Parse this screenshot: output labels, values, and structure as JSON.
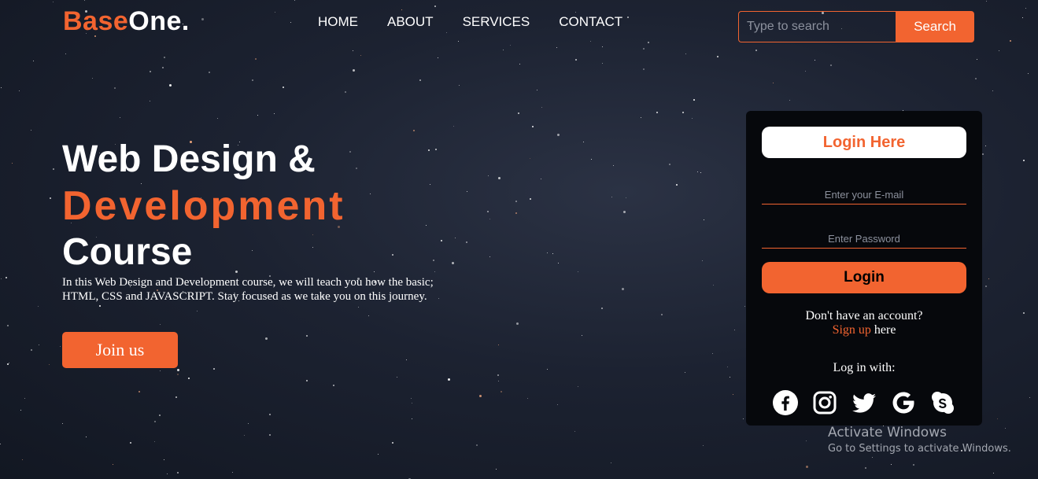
{
  "header": {
    "logo_part1": "Base",
    "logo_part2": "One.",
    "nav": [
      "HOME",
      "ABOUT",
      "SERVICES",
      "CONTACT"
    ],
    "search_placeholder": "Type to search",
    "search_button": "Search"
  },
  "hero": {
    "line1": "Web Design &",
    "line2": "Development",
    "line3": "Course",
    "description": "In this Web Design and Development course, we will teach you how the basic; HTML, CSS and JAVASCRIPT. Stay focused as we take you on this journey.",
    "cta": "Join us"
  },
  "login": {
    "title": "Login Here",
    "email_placeholder": "Enter your E-mail",
    "password_placeholder": "Enter Password",
    "button": "Login",
    "no_account": "Don't have an account?",
    "signup_link": "Sign up",
    "signup_suffix": " here",
    "login_with": "Log in with:",
    "socials": [
      "facebook-icon",
      "instagram-icon",
      "twitter-icon",
      "google-icon",
      "skype-icon"
    ]
  },
  "watermark": {
    "title": "Activate Windows",
    "subtitle": "Go to Settings to activate Windows."
  },
  "colors": {
    "accent": "#f26430",
    "panel": "#06080c"
  }
}
